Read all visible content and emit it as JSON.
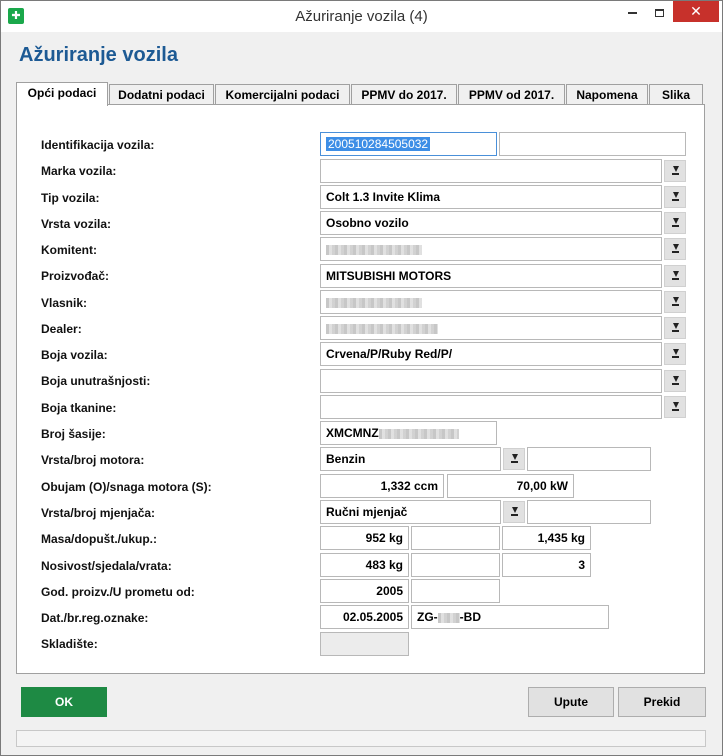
{
  "window": {
    "title": "Ažuriranje vozila (4)",
    "app_icon": "app-cross-icon",
    "controls": {
      "minimize": "minimize-icon",
      "maximize": "maximize-icon",
      "close": "✕"
    }
  },
  "heading": "Ažuriranje vozila",
  "tabs": [
    {
      "label": "Opći podaci",
      "active": true
    },
    {
      "label": "Dodatni podaci",
      "active": false
    },
    {
      "label": "Komercijalni podaci",
      "active": false
    },
    {
      "label": "PPMV do 2017.",
      "active": false
    },
    {
      "label": "PPMV od 2017.",
      "active": false
    },
    {
      "label": "Napomena",
      "active": false
    },
    {
      "label": "Slika",
      "active": false
    }
  ],
  "form": {
    "identifikacija": {
      "label": "Identifikacija vozila:",
      "value": "200510284505032",
      "value2": ""
    },
    "marka": {
      "label": "Marka vozila:",
      "value": ""
    },
    "tip": {
      "label": "Tip vozila:",
      "value": "Colt 1.3 Invite Klima"
    },
    "vrsta": {
      "label": "Vrsta vozila:",
      "value": "Osobno vozilo"
    },
    "komitent": {
      "label": "Komitent:",
      "value": "[redacted]"
    },
    "proizvodac": {
      "label": "Proizvođač:",
      "value": "MITSUBISHI MOTORS"
    },
    "vlasnik": {
      "label": "Vlasnik:",
      "value": "[redacted]"
    },
    "dealer": {
      "label": "Dealer:",
      "value": "[redacted]"
    },
    "boja_vozila": {
      "label": "Boja vozila:",
      "value": "Crvena/P/Ruby Red/P/"
    },
    "boja_unutrasnjosti": {
      "label": "Boja unutrašnjosti:",
      "value": ""
    },
    "boja_tkanine": {
      "label": "Boja tkanine:",
      "value": ""
    },
    "broj_sasije": {
      "label": "Broj šasije:",
      "value_prefix": "XMCMNZ"
    },
    "motor": {
      "label": "Vrsta/broj motora:",
      "value": "Benzin",
      "value2": ""
    },
    "obujam": {
      "label": "Obujam (O)/snaga motora (S):",
      "obujam": "1,332 ccm",
      "snaga": "70,00 kW"
    },
    "mjenjac": {
      "label": "Vrsta/broj mjenjača:",
      "value": "Ručni mjenjač",
      "value2": ""
    },
    "masa": {
      "label": "Masa/dopušt./ukup.:",
      "masa": "952 kg",
      "dopust": "",
      "ukup": "1,435 kg"
    },
    "nosivost": {
      "label": "Nosivost/sjedala/vrata:",
      "nosivost": "483 kg",
      "sjedala": "",
      "vrata": "3"
    },
    "god_proizv": {
      "label": "God. proizv./U prometu od:",
      "god": "2005",
      "u_prometu": ""
    },
    "dat_reg": {
      "label": "Dat./br.reg.oznake:",
      "datum": "02.05.2005",
      "oznaka_prefix": "ZG-",
      "oznaka_suffix": "-BD"
    },
    "skladiste": {
      "label": "Skladište:",
      "value": ""
    }
  },
  "buttons": {
    "ok": "OK",
    "upute": "Upute",
    "prekid": "Prekid"
  },
  "colors": {
    "heading": "#1d5a94",
    "ok_button": "#1e8a44",
    "close_button": "#c7312b",
    "selection": "#3d8ee6"
  }
}
